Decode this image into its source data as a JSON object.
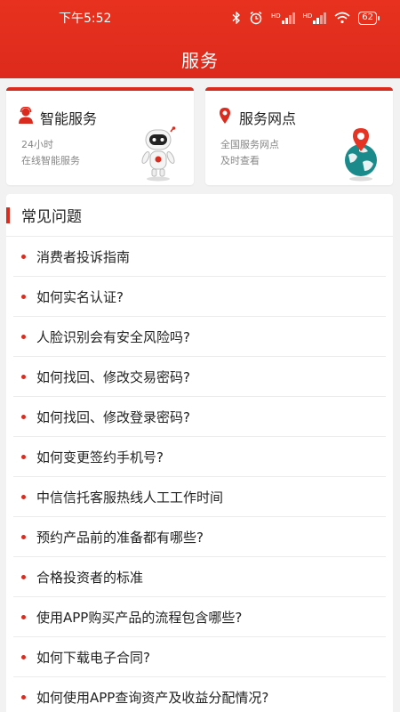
{
  "status_bar": {
    "time": "下午5:52",
    "battery": "62",
    "network_badge_1": "HD",
    "network_badge_2": "HD"
  },
  "header": {
    "title": "服务"
  },
  "cards": [
    {
      "title": "智能服务",
      "line1": "24小时",
      "line2": "在线智能服务",
      "icon": "user-service-icon"
    },
    {
      "title": "服务网点",
      "line1": "全国服务网点",
      "line2": "及时查看",
      "icon": "location-pin-icon"
    }
  ],
  "faq": {
    "title": "常见问题",
    "items": [
      "消费者投诉指南",
      "如何实名认证?",
      "人脸识别会有安全风险吗?",
      "如何找回、修改交易密码?",
      "如何找回、修改登录密码?",
      "如何变更签约手机号?",
      "中信信托客服热线人工工作时间",
      "预约产品前的准备都有哪些?",
      "合格投资者的标准",
      "使用APP购买产品的流程包含哪些?",
      "如何下载电子合同?",
      "如何使用APP查询资产及收益分配情况?"
    ]
  },
  "colors": {
    "brand_red": "#d92c1f",
    "header_red": "#e8321f",
    "background": "#f2f2f2"
  }
}
